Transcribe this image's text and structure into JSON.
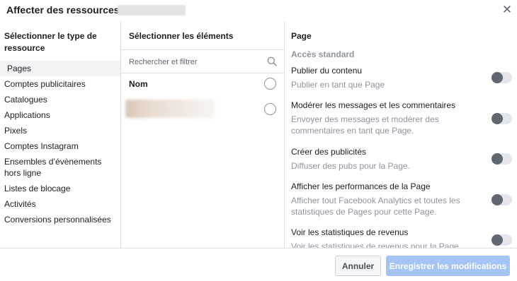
{
  "dialog": {
    "title": "Affecter des ressources à",
    "close_icon": "close-icon"
  },
  "resource_types": {
    "header": "Sélectionner le type de ressource",
    "items": [
      {
        "label": "Pages",
        "selected": true
      },
      {
        "label": "Comptes publicitaires",
        "selected": false
      },
      {
        "label": "Catalogues",
        "selected": false
      },
      {
        "label": "Applications",
        "selected": false
      },
      {
        "label": "Pixels",
        "selected": false
      },
      {
        "label": "Comptes Instagram",
        "selected": false
      },
      {
        "label": "Ensembles d’évènements hors ligne",
        "selected": false
      },
      {
        "label": "Listes de blocage",
        "selected": false
      },
      {
        "label": "Activités",
        "selected": false
      },
      {
        "label": "Conversions personnalisées",
        "selected": false
      }
    ]
  },
  "elements": {
    "header": "Sélectionner les éléments",
    "search_placeholder": "Rechercher et filtrer",
    "search_icon": "search-icon",
    "column_label": "Nom"
  },
  "permissions": {
    "header": "Page",
    "section": "Accès standard",
    "items": [
      {
        "title": "Publier du contenu",
        "description": "Publier en tant que Page",
        "enabled": false
      },
      {
        "title": "Modérer les messages et les commentaires",
        "description": "Envoyer des messages et modérer des commentaires en tant que Page.",
        "enabled": false
      },
      {
        "title": "Créer des publicités",
        "description": "Diffuser des pubs pour la Page.",
        "enabled": false
      },
      {
        "title": "Afficher les performances de la Page",
        "description": "Afficher tout Facebook Analytics et toutes les statistiques de Pages pour cette Page.",
        "enabled": false
      },
      {
        "title": "Voir les statistiques de revenus",
        "description": "Voir les statistiques de revenus pour la Page.",
        "enabled": false
      }
    ]
  },
  "footer": {
    "cancel_label": "Annuler",
    "save_label": "Enregistrer les modifications",
    "save_color": "#a3c4f5"
  }
}
